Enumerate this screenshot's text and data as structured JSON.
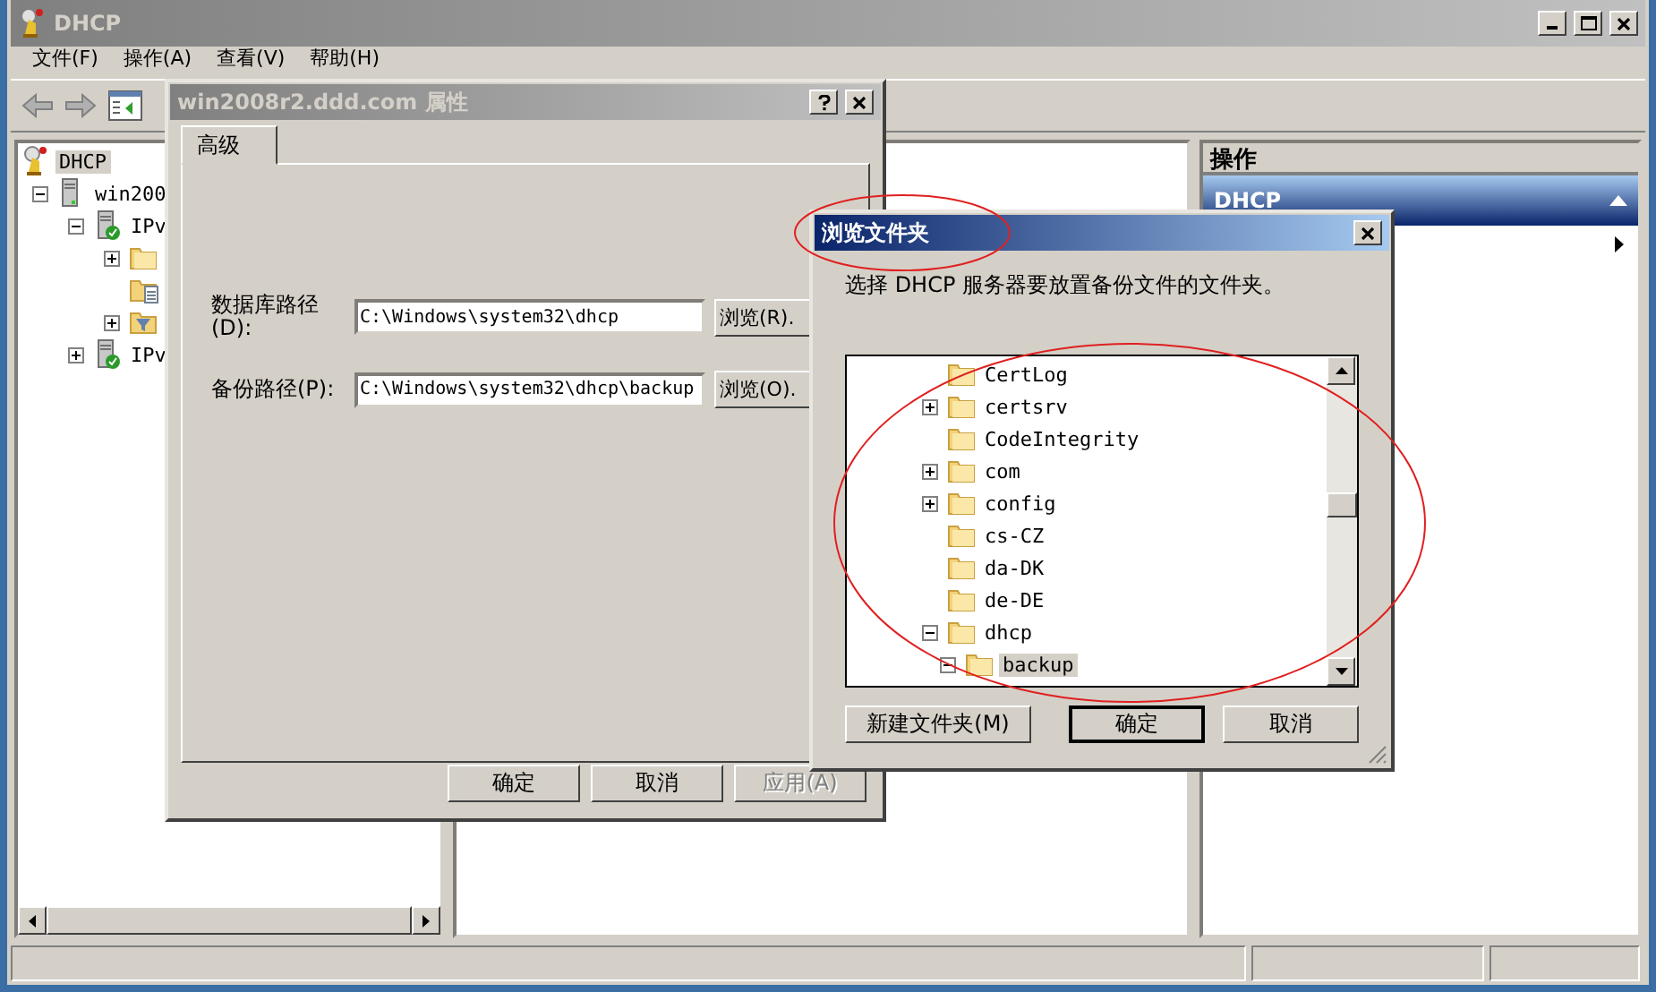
{
  "main_window": {
    "title": "DHCP",
    "active": false,
    "menu": [
      "文件(F)",
      "操作(A)",
      "查看(V)",
      "帮助(H)"
    ],
    "tree": [
      {
        "label": "DHCP",
        "kind": "dhcp",
        "selected": true,
        "children": [
          {
            "label": "win200",
            "kind": "server",
            "expanded": true,
            "selected": false,
            "children": [
              {
                "label": "IPv",
                "kind": "server-ok",
                "expanded": true,
                "selected": false,
                "children": [
                  {
                    "kind": "folder",
                    "expanded": false,
                    "selected": false
                  },
                  {
                    "kind": "folder-list",
                    "selected": false
                  },
                  {
                    "kind": "filter",
                    "expanded": false,
                    "selected": false
                  }
                ]
              },
              {
                "label": "IPv",
                "kind": "server-ok",
                "expanded": false,
                "selected": false
              }
            ]
          }
        ]
      }
    ],
    "actions": {
      "title": "操作",
      "section": "DHCP",
      "expanded": true
    }
  },
  "properties_dialog": {
    "title": "win2008r2.ddd.com 属性",
    "active": false,
    "tabs": [
      {
        "label": "高级",
        "selected": true
      }
    ],
    "fields": [
      {
        "label": "数据库路径(D):",
        "value": "C:\\Windows\\system32\\dhcp",
        "button": "浏览(R)."
      },
      {
        "label": "备份路径(P):",
        "value": "C:\\Windows\\system32\\dhcp\\backup",
        "button": "浏览(O)."
      }
    ],
    "buttons": [
      {
        "label": "确定",
        "disabled": false
      },
      {
        "label": "取消",
        "disabled": false
      },
      {
        "label": "应用(A)",
        "disabled": true
      }
    ]
  },
  "browse_dialog": {
    "title": "浏览文件夹",
    "active": true,
    "prompt": "选择 DHCP 服务器要放置备份文件的文件夹。",
    "folders": [
      {
        "name": "CertLog",
        "selected": false
      },
      {
        "name": "certsrv",
        "expanded": false,
        "selected": false
      },
      {
        "name": "CodeIntegrity",
        "selected": false
      },
      {
        "name": "com",
        "expanded": false,
        "selected": false
      },
      {
        "name": "config",
        "expanded": false,
        "selected": false
      },
      {
        "name": "cs-CZ",
        "selected": false
      },
      {
        "name": "da-DK",
        "selected": false
      },
      {
        "name": "de-DE",
        "selected": false
      },
      {
        "name": "dhcp",
        "expanded": true,
        "selected": false,
        "children": [
          {
            "name": "backup",
            "expanded": true,
            "selected": true
          }
        ]
      }
    ],
    "buttons": [
      {
        "label": "新建文件夹(M)",
        "default": false
      },
      {
        "label": "确定",
        "default": true
      },
      {
        "label": "取消",
        "default": false
      }
    ]
  }
}
